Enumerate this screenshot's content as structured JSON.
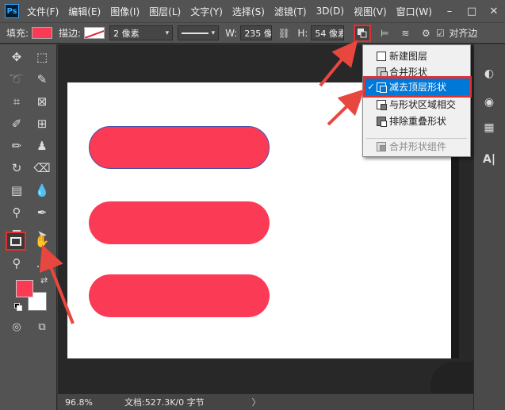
{
  "app": {
    "logo": "Ps",
    "menu": [
      "文件(F)",
      "编辑(E)",
      "图像(I)",
      "图层(L)",
      "文字(Y)",
      "选择(S)",
      "滤镜(T)",
      "3D(D)",
      "视图(V)",
      "窗口(W)"
    ],
    "window_buttons": [
      "–",
      "□",
      "✕"
    ]
  },
  "options": {
    "fill_label": "填充:",
    "fill_color": "#fb3a55",
    "stroke_label": "描边:",
    "stroke_width": "2 像素",
    "w_label": "W:",
    "w_value": "235 像",
    "link_icon": "link-icon",
    "h_label": "H:",
    "h_value": "54 像素",
    "align_edges_label": "对齐边"
  },
  "path_ops_menu": {
    "items": [
      {
        "label": "新建图层",
        "checked": false,
        "icon": "new-layer-op-icon",
        "state": "normal"
      },
      {
        "label": "合并形状",
        "checked": false,
        "icon": "combine-shapes-icon",
        "state": "normal"
      },
      {
        "label": "减去顶层形状",
        "checked": true,
        "icon": "subtract-front-shape-icon",
        "state": "highlighted"
      },
      {
        "label": "与形状区域相交",
        "checked": false,
        "icon": "intersect-shapes-icon",
        "state": "normal"
      },
      {
        "label": "排除重叠形状",
        "checked": false,
        "icon": "exclude-overlap-icon",
        "state": "normal"
      },
      {
        "label": "合并形状组件",
        "checked": false,
        "icon": "merge-components-icon",
        "state": "disabled"
      }
    ],
    "check_glyph": "✓"
  },
  "canvas": {
    "shape_color": "#fb3a55",
    "shapes": 3
  },
  "status": {
    "zoom": "96.8%",
    "doc_info": "文档:527.3K/0 字节",
    "arrow": "〉"
  },
  "colors": {
    "accent_red": "#e03030",
    "highlight_blue": "#0078d7",
    "foreground": "#fb3a55",
    "background": "#ffffff"
  }
}
